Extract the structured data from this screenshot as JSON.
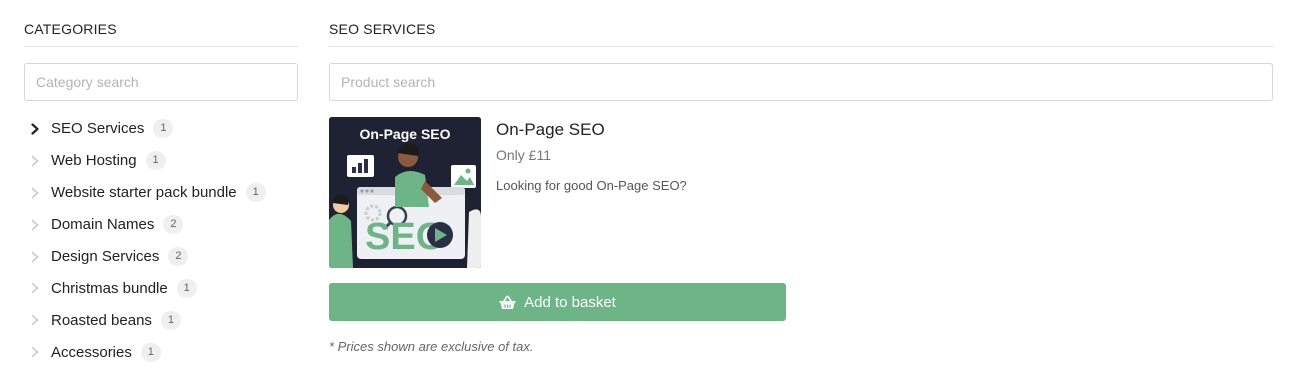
{
  "sidebar": {
    "title": "CATEGORIES",
    "search_placeholder": "Category search",
    "categories": [
      {
        "label": "SEO Services",
        "count": "1",
        "active": true
      },
      {
        "label": "Web Hosting",
        "count": "1"
      },
      {
        "label": "Website starter pack bundle",
        "count": "1"
      },
      {
        "label": "Domain Names",
        "count": "2"
      },
      {
        "label": "Design Services",
        "count": "2"
      },
      {
        "label": "Christmas bundle",
        "count": "1"
      },
      {
        "label": "Roasted beans",
        "count": "1"
      },
      {
        "label": "Accessories",
        "count": "1"
      }
    ]
  },
  "main": {
    "title": "SEO SERVICES",
    "search_placeholder": "Product search",
    "product": {
      "image_caption": "On-Page SEO",
      "image_word": "SEO",
      "name": "On-Page SEO",
      "price": "Only £11",
      "description": "Looking for good On-Page SEO?",
      "add_label": "Add to basket",
      "add_icon": "basket-icon"
    },
    "tax_note": "* Prices shown are exclusive of tax."
  },
  "colors": {
    "accent": "#6db587",
    "thumb_bg": "#1e2233",
    "badge_bg": "#efefef"
  }
}
